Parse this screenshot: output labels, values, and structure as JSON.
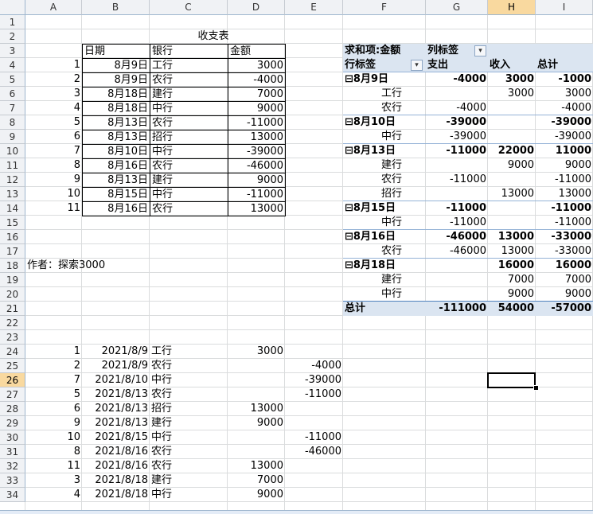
{
  "columns": [
    "A",
    "B",
    "C",
    "D",
    "E",
    "F",
    "G",
    "H",
    "I"
  ],
  "selected_column": "H",
  "selected_row": 26,
  "title": "收支表",
  "table1": {
    "headers": [
      "日期",
      "银行",
      "金额"
    ],
    "rows": [
      {
        "n": "1",
        "date": "8月9日",
        "bank": "工行",
        "amount": "3000"
      },
      {
        "n": "2",
        "date": "8月9日",
        "bank": "农行",
        "amount": "-4000"
      },
      {
        "n": "3",
        "date": "8月18日",
        "bank": "建行",
        "amount": "7000"
      },
      {
        "n": "4",
        "date": "8月18日",
        "bank": "中行",
        "amount": "9000"
      },
      {
        "n": "5",
        "date": "8月13日",
        "bank": "农行",
        "amount": "-11000"
      },
      {
        "n": "6",
        "date": "8月13日",
        "bank": "招行",
        "amount": "13000"
      },
      {
        "n": "7",
        "date": "8月10日",
        "bank": "中行",
        "amount": "-39000"
      },
      {
        "n": "8",
        "date": "8月16日",
        "bank": "农行",
        "amount": "-46000"
      },
      {
        "n": "9",
        "date": "8月13日",
        "bank": "建行",
        "amount": "9000"
      },
      {
        "n": "10",
        "date": "8月15日",
        "bank": "中行",
        "amount": "-11000"
      },
      {
        "n": "11",
        "date": "8月16日",
        "bank": "农行",
        "amount": "13000"
      }
    ]
  },
  "author": "作者：探索3000",
  "pivot": {
    "value_field": "求和项:金额",
    "col_label": "列标签",
    "row_label": "行标签",
    "col_headers": [
      "支出",
      "收入",
      "总计"
    ],
    "filter_icon": "dropdown-arrow-icon",
    "sort_icon": "sort-filter-icon",
    "rows": [
      {
        "label": "8月9日",
        "group": true,
        "exp": "-4000",
        "inc": "3000",
        "tot": "-1000"
      },
      {
        "label": "工行",
        "group": false,
        "exp": "",
        "inc": "3000",
        "tot": "3000"
      },
      {
        "label": "农行",
        "group": false,
        "exp": "-4000",
        "inc": "",
        "tot": "-4000"
      },
      {
        "label": "8月10日",
        "group": true,
        "exp": "-39000",
        "inc": "",
        "tot": "-39000"
      },
      {
        "label": "中行",
        "group": false,
        "exp": "-39000",
        "inc": "",
        "tot": "-39000"
      },
      {
        "label": "8月13日",
        "group": true,
        "exp": "-11000",
        "inc": "22000",
        "tot": "11000"
      },
      {
        "label": "建行",
        "group": false,
        "exp": "",
        "inc": "9000",
        "tot": "9000"
      },
      {
        "label": "农行",
        "group": false,
        "exp": "-11000",
        "inc": "",
        "tot": "-11000"
      },
      {
        "label": "招行",
        "group": false,
        "exp": "",
        "inc": "13000",
        "tot": "13000"
      },
      {
        "label": "8月15日",
        "group": true,
        "exp": "-11000",
        "inc": "",
        "tot": "-11000"
      },
      {
        "label": "中行",
        "group": false,
        "exp": "-11000",
        "inc": "",
        "tot": "-11000"
      },
      {
        "label": "8月16日",
        "group": true,
        "exp": "-46000",
        "inc": "13000",
        "tot": "-33000"
      },
      {
        "label": "农行",
        "group": false,
        "exp": "-46000",
        "inc": "13000",
        "tot": "-33000"
      },
      {
        "label": "8月18日",
        "group": true,
        "exp": "",
        "inc": "16000",
        "tot": "16000"
      },
      {
        "label": "建行",
        "group": false,
        "exp": "",
        "inc": "7000",
        "tot": "7000"
      },
      {
        "label": "中行",
        "group": false,
        "exp": "",
        "inc": "9000",
        "tot": "9000"
      }
    ],
    "total": {
      "label": "总计",
      "exp": "-111000",
      "inc": "54000",
      "tot": "-57000"
    }
  },
  "table2": [
    {
      "n": "1",
      "date": "2021/8/9",
      "bank": "工行",
      "d": "3000",
      "e": ""
    },
    {
      "n": "2",
      "date": "2021/8/9",
      "bank": "农行",
      "d": "",
      "e": "-4000"
    },
    {
      "n": "7",
      "date": "2021/8/10",
      "bank": "中行",
      "d": "",
      "e": "-39000"
    },
    {
      "n": "5",
      "date": "2021/8/13",
      "bank": "农行",
      "d": "",
      "e": "-11000"
    },
    {
      "n": "6",
      "date": "2021/8/13",
      "bank": "招行",
      "d": "13000",
      "e": ""
    },
    {
      "n": "9",
      "date": "2021/8/13",
      "bank": "建行",
      "d": "9000",
      "e": ""
    },
    {
      "n": "10",
      "date": "2021/8/15",
      "bank": "中行",
      "d": "",
      "e": "-11000"
    },
    {
      "n": "8",
      "date": "2021/8/16",
      "bank": "农行",
      "d": "",
      "e": "-46000"
    },
    {
      "n": "11",
      "date": "2021/8/16",
      "bank": "农行",
      "d": "13000",
      "e": ""
    },
    {
      "n": "3",
      "date": "2021/8/18",
      "bank": "建行",
      "d": "7000",
      "e": ""
    },
    {
      "n": "4",
      "date": "2021/8/18",
      "bank": "中行",
      "d": "9000",
      "e": ""
    }
  ]
}
